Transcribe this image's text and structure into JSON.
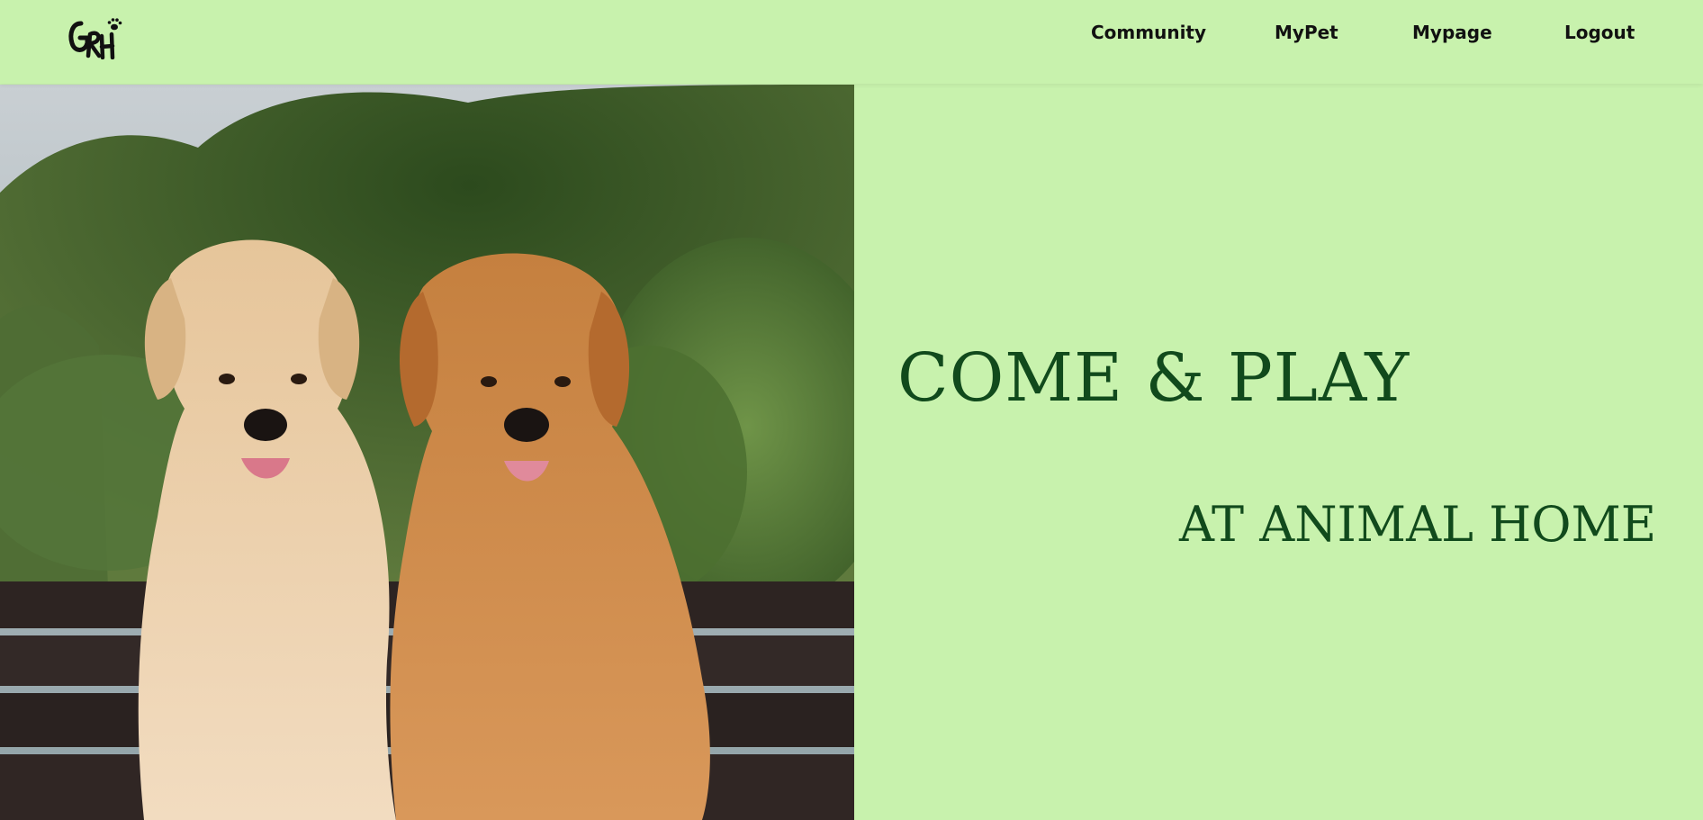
{
  "header": {
    "logo_text": "GRH",
    "nav": {
      "community": "Community",
      "mypet": "MyPet",
      "mypage": "Mypage",
      "logout": "Logout"
    }
  },
  "hero": {
    "headline": "COME & PLAY",
    "subheadline": "AT ANIMAL HOME"
  },
  "colors": {
    "background": "#c8f2ad",
    "headline": "#114a1c",
    "nav_text": "#111111"
  },
  "icons": {
    "logo": "paw-logo-icon"
  }
}
